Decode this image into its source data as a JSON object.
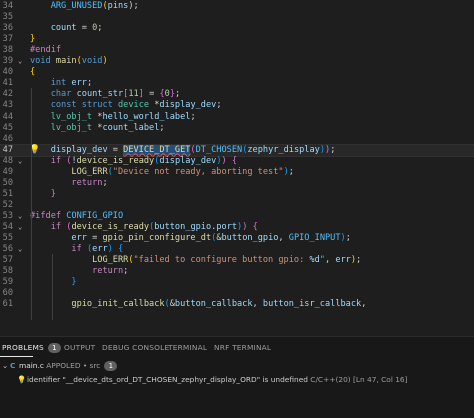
{
  "editor": {
    "lines": [
      {
        "n": "34",
        "tokens": [
          [
            "    ",
            "p"
          ],
          [
            "ARG_UNUSED",
            "m"
          ],
          [
            "(",
            "b1"
          ],
          [
            "pins",
            "v"
          ],
          [
            ");",
            "p"
          ]
        ]
      },
      {
        "n": "35",
        "tokens": []
      },
      {
        "n": "36",
        "tokens": [
          [
            "    ",
            "p"
          ],
          [
            "count",
            "v"
          ],
          [
            " = ",
            "p"
          ],
          [
            "0",
            "n"
          ],
          [
            ";",
            "p"
          ]
        ]
      },
      {
        "n": "37",
        "tokens": [
          [
            "}",
            "b1"
          ]
        ]
      },
      {
        "n": "38",
        "tokens": [
          [
            "#endif",
            "c"
          ]
        ]
      },
      {
        "n": "39",
        "tokens": [],
        "blank": true
      },
      {
        "n": "39",
        "tokens": [
          [
            "void",
            "k"
          ],
          [
            " ",
            "p"
          ],
          [
            "main",
            "f"
          ],
          [
            "(",
            "b1"
          ],
          [
            "void",
            "k"
          ],
          [
            ")",
            "b1"
          ]
        ],
        "fold": true
      },
      {
        "n": "40",
        "tokens": [
          [
            "{",
            "b1"
          ]
        ]
      },
      {
        "n": "41",
        "tokens": [
          [
            "    ",
            "p"
          ],
          [
            "int",
            "k"
          ],
          [
            " ",
            "p"
          ],
          [
            "err",
            "v"
          ],
          [
            ";",
            "p"
          ]
        ]
      },
      {
        "n": "42",
        "tokens": [
          [
            "    ",
            "p"
          ],
          [
            "char",
            "k"
          ],
          [
            " ",
            "p"
          ],
          [
            "count_str",
            "v"
          ],
          [
            "[",
            "b2"
          ],
          [
            "11",
            "n"
          ],
          [
            "]",
            "b2"
          ],
          [
            " = ",
            "p"
          ],
          [
            "{",
            "b2"
          ],
          [
            "0",
            "n"
          ],
          [
            "}",
            "b2"
          ],
          [
            ";",
            "p"
          ]
        ]
      },
      {
        "n": "43",
        "tokens": [
          [
            "    ",
            "p"
          ],
          [
            "const",
            "k"
          ],
          [
            " ",
            "p"
          ],
          [
            "struct",
            "k"
          ],
          [
            " ",
            "p"
          ],
          [
            "device",
            "t"
          ],
          [
            " *",
            "p"
          ],
          [
            "display_dev",
            "v"
          ],
          [
            ";",
            "p"
          ]
        ]
      },
      {
        "n": "44",
        "tokens": [
          [
            "    ",
            "p"
          ],
          [
            "lv_obj_t",
            "t"
          ],
          [
            " *",
            "p"
          ],
          [
            "hello_world_label",
            "v"
          ],
          [
            ";",
            "p"
          ]
        ]
      },
      {
        "n": "45",
        "tokens": [
          [
            "    ",
            "p"
          ],
          [
            "lv_obj_t",
            "t"
          ],
          [
            " *",
            "p"
          ],
          [
            "count_label",
            "v"
          ],
          [
            ";",
            "p"
          ]
        ]
      },
      {
        "n": "46",
        "tokens": []
      },
      {
        "n": "47",
        "tokens": [
          [
            "    ",
            "p"
          ],
          [
            "display_dev",
            "v"
          ],
          [
            " = ",
            "p"
          ],
          [
            "DEVICE_DT_GET",
            "sq"
          ],
          [
            "(",
            "b2"
          ],
          [
            "DT_CHOSEN",
            "m"
          ],
          [
            "(",
            "b3"
          ],
          [
            "zephyr_display",
            "v"
          ],
          [
            ")",
            "b3"
          ],
          [
            ")",
            "b2"
          ],
          [
            ";",
            "p"
          ]
        ],
        "current": true,
        "bulb": true
      },
      {
        "n": "48",
        "tokens": [
          [
            "    ",
            "p"
          ],
          [
            "if",
            "c"
          ],
          [
            " ",
            "p"
          ],
          [
            "(",
            "b2"
          ],
          [
            "!",
            "p"
          ],
          [
            "device_is_ready",
            "f"
          ],
          [
            "(",
            "b3"
          ],
          [
            "display_dev",
            "v"
          ],
          [
            ")",
            "b3"
          ],
          [
            ")",
            "b2"
          ],
          [
            " ",
            "p"
          ],
          [
            "{",
            "b2"
          ]
        ],
        "fold": true
      },
      {
        "n": "49",
        "tokens": [
          [
            "        ",
            "p"
          ],
          [
            "LOG_ERR",
            "f"
          ],
          [
            "(",
            "b3"
          ],
          [
            "\"Device not ready, aborting test\"",
            "s"
          ],
          [
            ")",
            "b3"
          ],
          [
            ";",
            "p"
          ]
        ]
      },
      {
        "n": "50",
        "tokens": [
          [
            "        ",
            "p"
          ],
          [
            "return",
            "c"
          ],
          [
            ";",
            "p"
          ]
        ]
      },
      {
        "n": "51",
        "tokens": [
          [
            "    ",
            "p"
          ],
          [
            "}",
            "b2"
          ]
        ]
      },
      {
        "n": "52",
        "tokens": []
      },
      {
        "n": "53",
        "tokens": [
          [
            "#ifdef",
            "c"
          ],
          [
            " ",
            "p"
          ],
          [
            "CONFIG_GPIO",
            "m"
          ]
        ],
        "fold": true
      },
      {
        "n": "54",
        "tokens": [
          [
            "    ",
            "p"
          ],
          [
            "if",
            "c"
          ],
          [
            " ",
            "p"
          ],
          [
            "(",
            "b2"
          ],
          [
            "device_is_ready",
            "f"
          ],
          [
            "(",
            "b3"
          ],
          [
            "button_gpio",
            "v"
          ],
          [
            ".",
            "p"
          ],
          [
            "port",
            "v"
          ],
          [
            ")",
            "b3"
          ],
          [
            ")",
            "b2"
          ],
          [
            " ",
            "p"
          ],
          [
            "{",
            "b2"
          ]
        ],
        "fold": true
      },
      {
        "n": "55",
        "tokens": [
          [
            "        ",
            "p"
          ],
          [
            "err",
            "v"
          ],
          [
            " = ",
            "p"
          ],
          [
            "gpio_pin_configure_dt",
            "f"
          ],
          [
            "(",
            "b3"
          ],
          [
            "&",
            "p"
          ],
          [
            "button_gpio",
            "v"
          ],
          [
            ", ",
            "p"
          ],
          [
            "GPIO_INPUT",
            "m"
          ],
          [
            ")",
            "b3"
          ],
          [
            ";",
            "p"
          ]
        ]
      },
      {
        "n": "56",
        "tokens": [
          [
            "        ",
            "p"
          ],
          [
            "if",
            "c"
          ],
          [
            " ",
            "p"
          ],
          [
            "(",
            "b3"
          ],
          [
            "err",
            "v"
          ],
          [
            ")",
            "b3"
          ],
          [
            " ",
            "p"
          ],
          [
            "{",
            "b3"
          ]
        ],
        "fold": true
      },
      {
        "n": "57",
        "tokens": [
          [
            "            ",
            "p"
          ],
          [
            "LOG_ERR",
            "f"
          ],
          [
            "(",
            "b1"
          ],
          [
            "\"failed to configure button gpio: ",
            "s"
          ],
          [
            "%d",
            "v"
          ],
          [
            "\"",
            "s"
          ],
          [
            ", ",
            "p"
          ],
          [
            "err",
            "v"
          ],
          [
            ")",
            "b1"
          ],
          [
            ";",
            "p"
          ]
        ]
      },
      {
        "n": "58",
        "tokens": [
          [
            "            ",
            "p"
          ],
          [
            "return",
            "c"
          ],
          [
            ";",
            "p"
          ]
        ]
      },
      {
        "n": "59",
        "tokens": [
          [
            "        ",
            "p"
          ],
          [
            "}",
            "b3"
          ]
        ]
      },
      {
        "n": "60",
        "tokens": []
      },
      {
        "n": "61",
        "tokens": [
          [
            "        ",
            "p"
          ],
          [
            "gpio_init_callback",
            "f"
          ],
          [
            "(",
            "b3"
          ],
          [
            "&",
            "p"
          ],
          [
            "button_callback",
            "v"
          ],
          [
            ", ",
            "p"
          ],
          [
            "button_isr_callback",
            "v"
          ],
          [
            ",",
            "p"
          ]
        ]
      }
    ]
  },
  "panel": {
    "tabs": [
      {
        "label": "PROBLEMS",
        "badge": "1",
        "active": true
      },
      {
        "label": "OUTPUT"
      },
      {
        "label": "DEBUG CONSOLE"
      },
      {
        "label": "TERMINAL"
      },
      {
        "label": "NRF TERMINAL"
      }
    ],
    "file_icon": "C",
    "file_name": "main.c",
    "file_path": " APPOLED • src",
    "file_count": "1",
    "message": "identifier \"__device_dts_ord_DT_CHOSEN_zephyr_display_ORD\" is undefined",
    "message_source": "  C/C++(20)  [Ln 47, Col 16]"
  },
  "icons": {
    "lightbulb": "lightbulb-icon",
    "chevron": "chevron-down-icon"
  }
}
